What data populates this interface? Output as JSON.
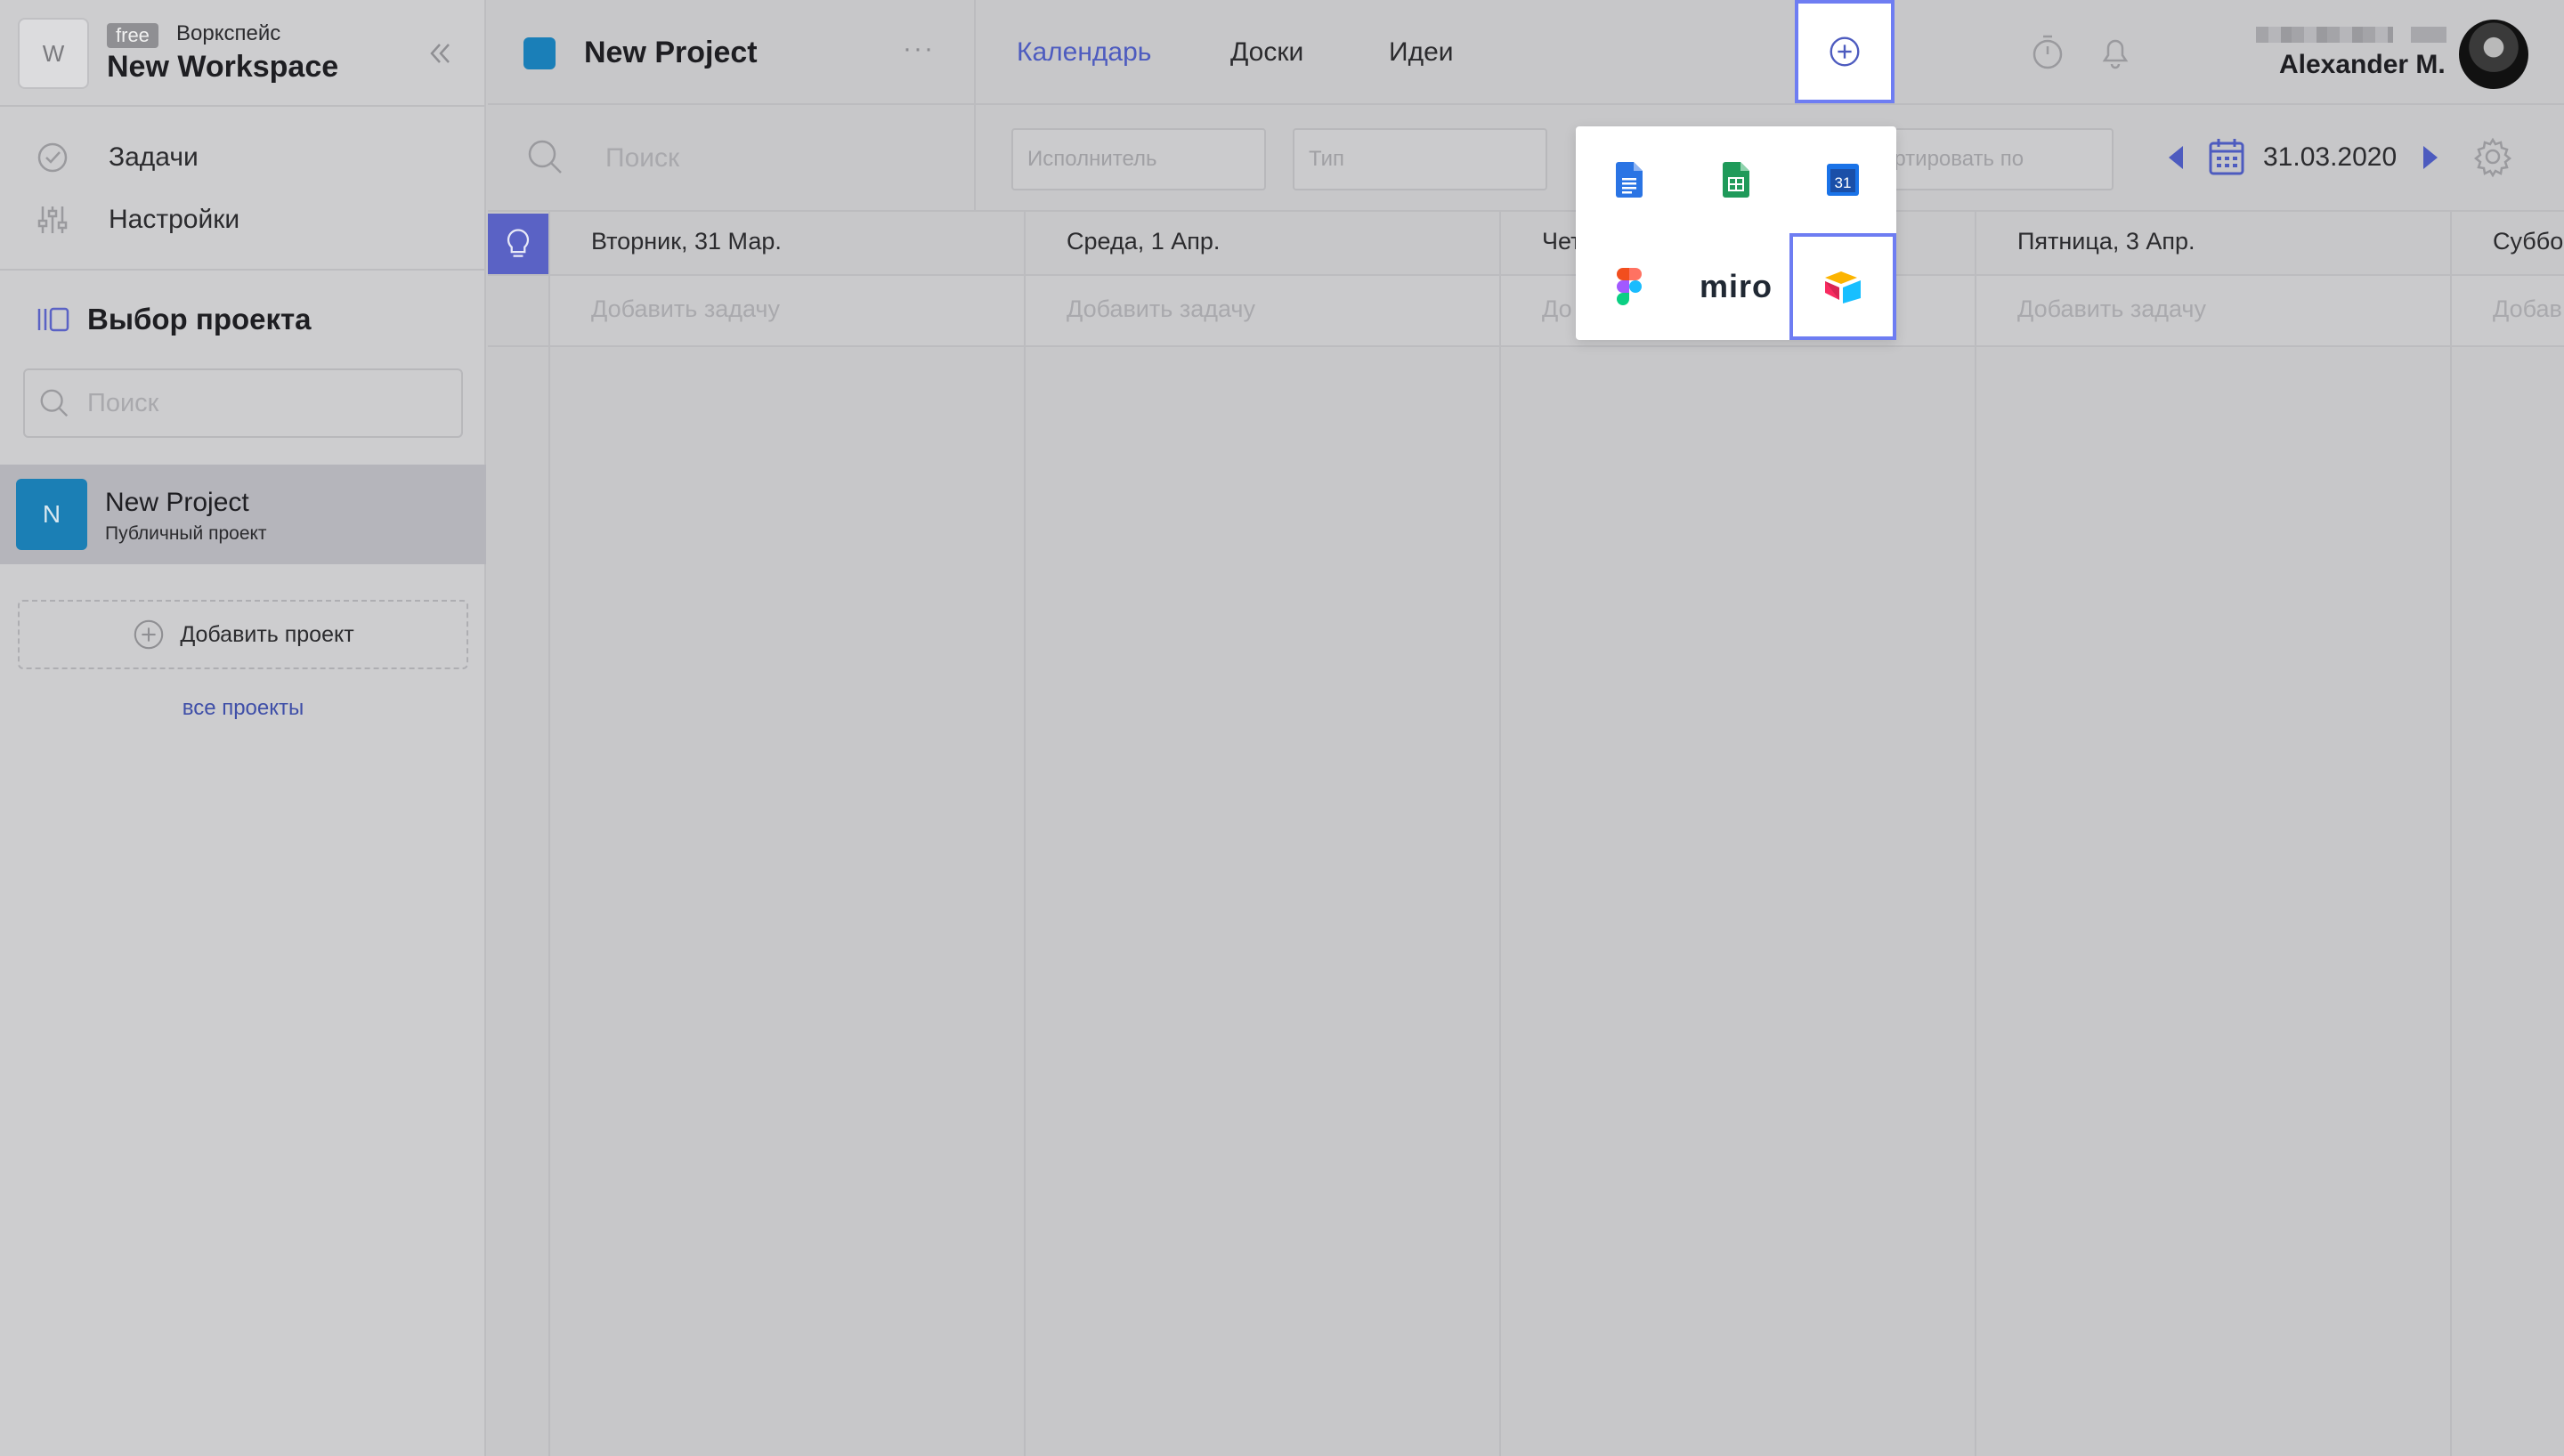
{
  "workspace": {
    "avatar_letter": "W",
    "plan_badge": "free",
    "kind_label": "Воркспейс",
    "name": "New Workspace"
  },
  "sidebar": {
    "nav": [
      {
        "label": "Задачи",
        "icon": "check-circle-icon"
      },
      {
        "label": "Настройки",
        "icon": "sliders-icon"
      }
    ],
    "section_title": "Выбор проекта",
    "search_placeholder": "Поиск",
    "projects": [
      {
        "letter": "N",
        "name": "New Project",
        "subtitle": "Публичный проект",
        "color": "#1b7fb5"
      }
    ],
    "add_project_label": "Добавить проект",
    "all_projects_link": "все проекты"
  },
  "header": {
    "project_title": "New Project",
    "project_color": "#1a7fb8",
    "menu_glyph": "···",
    "tabs": [
      {
        "label": "Календарь",
        "active": true
      },
      {
        "label": "Доски",
        "active": false
      },
      {
        "label": "Идеи",
        "active": false
      }
    ],
    "user_name": "Alexander M."
  },
  "filters": {
    "search_placeholder": "Поиск",
    "assignee_placeholder": "Исполнитель",
    "type_placeholder": "Тип",
    "sort_placeholder": "ортировать по",
    "date": "31.03.2020"
  },
  "calendar": {
    "days": [
      "Вторник, 31 Мар.",
      "Среда, 1 Апр.",
      "Чет",
      "Пятница, 3 Апр.",
      "Суббо"
    ],
    "add_task_label": "Добавить задачу",
    "add_task_partial": [
      "Добавить задачу",
      "Добавить задачу",
      "До",
      "Добавить задачу",
      "Добав"
    ]
  },
  "integrations": {
    "items": [
      {
        "name": "google-docs-icon"
      },
      {
        "name": "google-sheets-icon"
      },
      {
        "name": "google-calendar-icon",
        "text": "31"
      },
      {
        "name": "figma-icon"
      },
      {
        "name": "miro-icon",
        "text": "miro"
      },
      {
        "name": "airtable-icon",
        "selected": true
      }
    ]
  },
  "colors": {
    "accent": "#4d5bbf",
    "highlight_border": "#6e7df2",
    "ideas_button": "#5a62c5"
  }
}
